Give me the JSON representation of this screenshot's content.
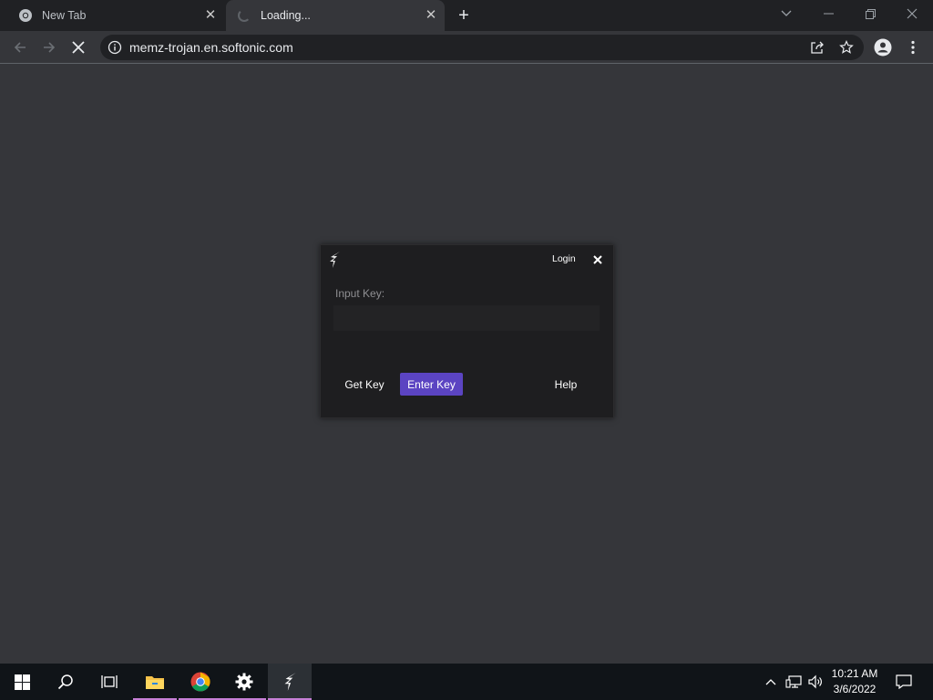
{
  "browser": {
    "tabs": [
      {
        "title": "New Tab",
        "favicon": "chrome-icon"
      },
      {
        "title": "Loading...",
        "favicon": "loading-spinner-icon"
      }
    ],
    "new_tab_icon": "plus-icon",
    "window_controls": [
      "tab-search-icon",
      "minimize-icon",
      "restore-icon",
      "close-icon"
    ],
    "address_bar": {
      "url": "memz-trojan.en.softonic.com"
    },
    "colors": {
      "frame": "#202124",
      "toolbar": "#35363a",
      "page": "#35363a"
    }
  },
  "dialog": {
    "login_label": "Login",
    "input_label": "Input Key:",
    "input_value": "",
    "buttons": {
      "get_key": "Get Key",
      "enter_key": "Enter Key",
      "help": "Help"
    },
    "colors": {
      "background": "#1e1e20",
      "accent": "#5b44c2"
    }
  },
  "taskbar": {
    "apps": [
      "start-icon",
      "search-icon",
      "task-view-icon",
      "file-explorer-icon",
      "chrome-icon",
      "settings-icon",
      "app-logo-icon"
    ],
    "clock": {
      "time": "10:21 AM",
      "date": "3/6/2022"
    }
  }
}
